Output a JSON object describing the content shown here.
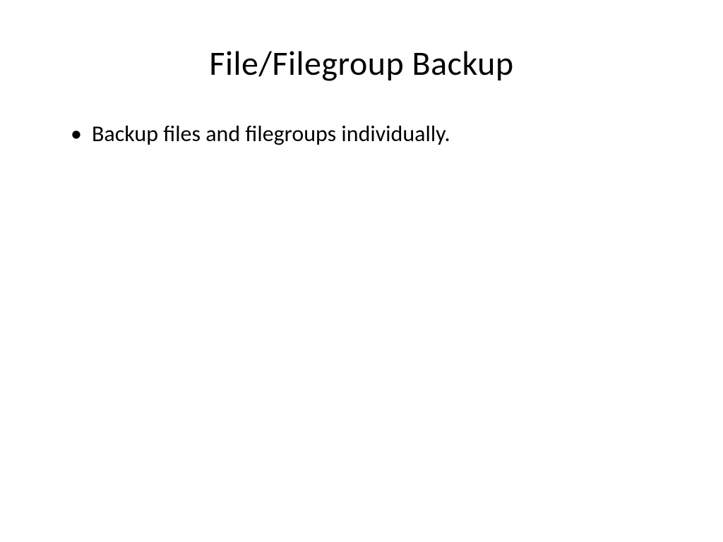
{
  "slide": {
    "title": "File/Filegroup Backup",
    "bullets": [
      "Backup files and filegroups individually."
    ]
  }
}
